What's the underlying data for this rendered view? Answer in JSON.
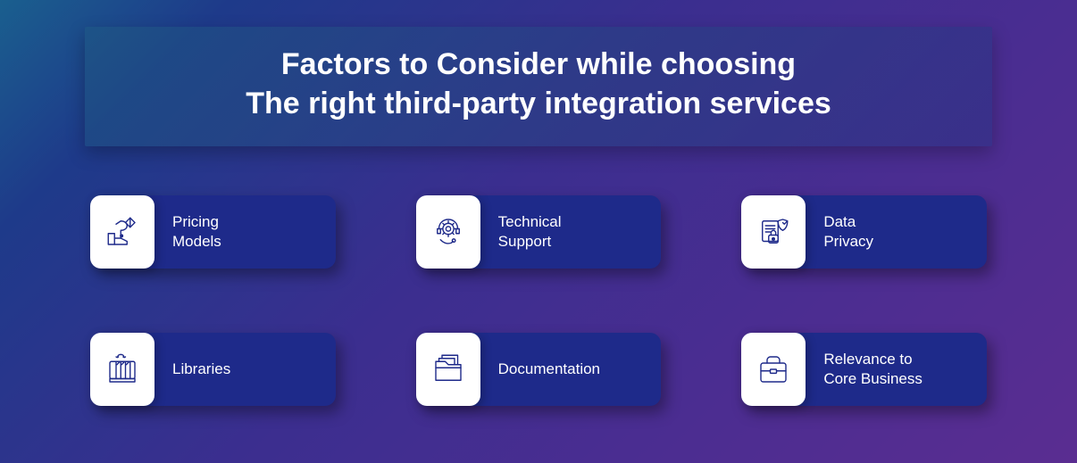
{
  "title_line1": "Factors to Consider while choosing",
  "title_line2": "The right third-party integration services",
  "chart_data": {
    "type": "table",
    "title": "Factors to Consider while choosing The right third-party integration services",
    "factors": [
      {
        "icon": "pricing",
        "label": "Pricing\nModels"
      },
      {
        "icon": "support",
        "label": "Technical\nSupport"
      },
      {
        "icon": "privacy",
        "label": "Data\nPrivacy"
      },
      {
        "icon": "libraries",
        "label": "Libraries"
      },
      {
        "icon": "documentation",
        "label": "Documentation"
      },
      {
        "icon": "relevance",
        "label": "Relevance to\nCore Business"
      }
    ]
  },
  "cards": [
    {
      "icon": "pricing-icon",
      "label": "Pricing\nModels"
    },
    {
      "icon": "support-icon",
      "label": "Technical\nSupport"
    },
    {
      "icon": "privacy-icon",
      "label": "Data\nPrivacy"
    },
    {
      "icon": "libraries-icon",
      "label": "Libraries"
    },
    {
      "icon": "documentation-icon",
      "label": "Documentation"
    },
    {
      "icon": "relevance-icon",
      "label": "Relevance to\nCore Business"
    }
  ]
}
